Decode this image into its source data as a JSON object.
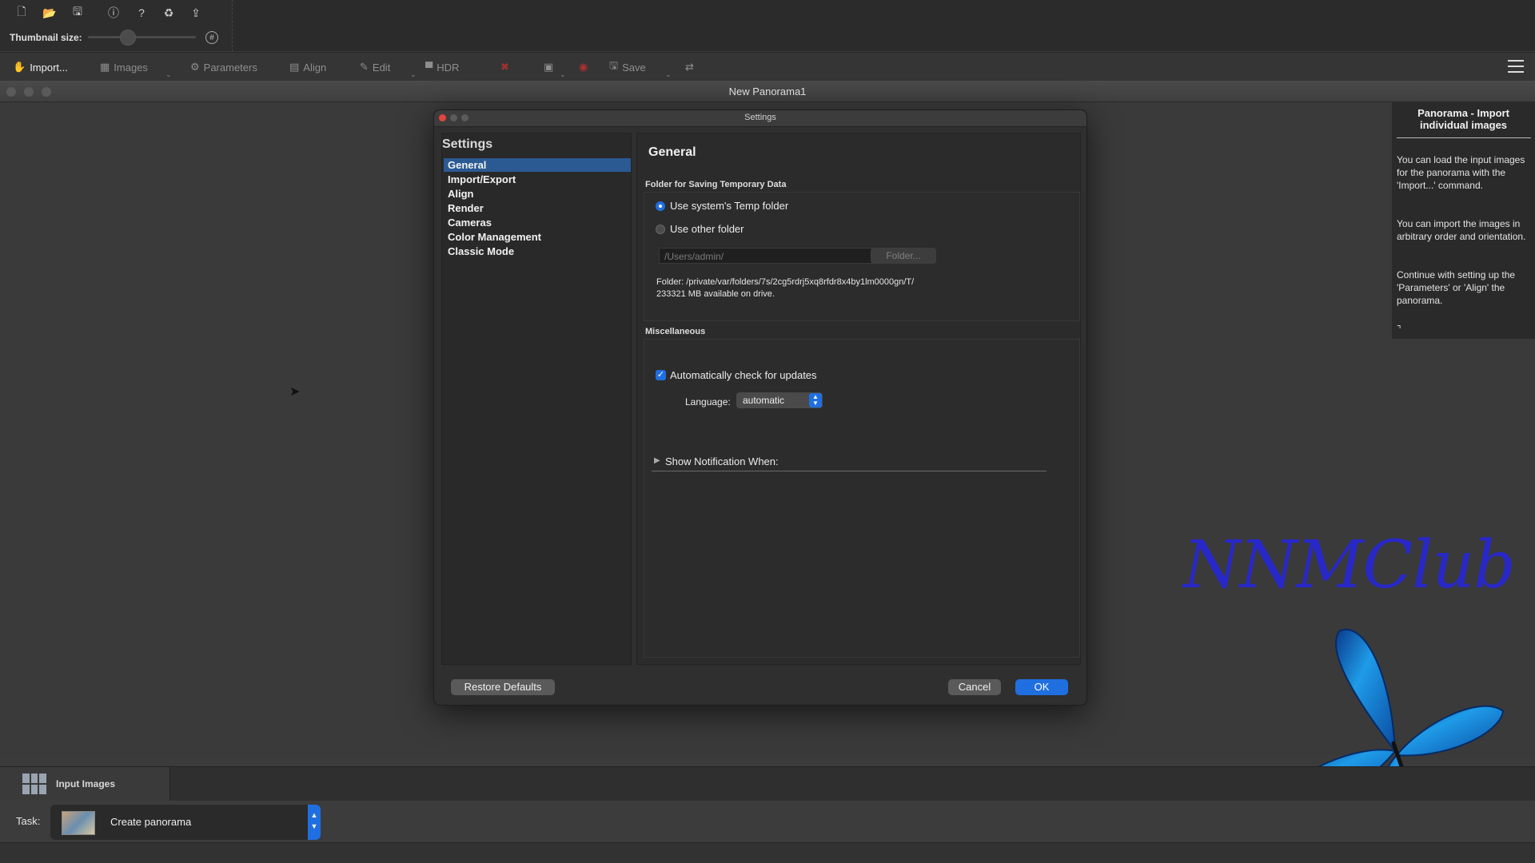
{
  "toolbar": {
    "thumbnail_label": "Thumbnail size:",
    "icons": [
      "new-file-icon",
      "open-folder-icon",
      "save-disk-icon",
      "info-icon",
      "help-icon",
      "recycle-icon",
      "export-icon"
    ]
  },
  "workflow": {
    "import": "Import...",
    "images": "Images",
    "parameters": "Parameters",
    "align": "Align",
    "edit": "Edit",
    "hdr": "HDR",
    "save": "Save"
  },
  "window": {
    "title": "New Panorama1"
  },
  "dialog": {
    "title": "Settings",
    "sidebar_heading": "Settings",
    "sidebar_items": [
      "General",
      "Import/Export",
      "Align",
      "Render",
      "Cameras",
      "Color Management",
      "Classic Mode"
    ],
    "selected_item": "General",
    "panel_title": "General",
    "temp_group_label": "Folder for Saving Temporary Data",
    "radio_system": "Use system's Temp folder",
    "radio_other": "Use other folder",
    "path_value": "/Users/admin/",
    "folder_button": "Folder...",
    "folder_info": "Folder: /private/var/folders/7s/2cg5rdrj5xq8rfdr8x4by1lm0000gn/T/",
    "space_info": "233321 MB available on drive.",
    "misc_group_label": "Miscellaneous",
    "auto_update_label": "Automatically check for updates",
    "auto_update_checked": true,
    "language_label": "Language:",
    "language_value": "automatic",
    "notification_label": "Show Notification When:",
    "restore_button": "Restore Defaults",
    "cancel_button": "Cancel",
    "ok_button": "OK"
  },
  "help": {
    "title": "Panorama - Import individual images",
    "p1": "You can load the input images for the panorama with the 'Import...' command.",
    "p2": "You can import the images in arbitrary order and orientation.",
    "p3": "Continue with setting up the 'Parameters' or 'Align' the panorama."
  },
  "watermark": "NNMClub",
  "bottom": {
    "input_tab": "Input Images",
    "task_label": "Task:",
    "task_value": "Create panorama"
  },
  "colors": {
    "accent": "#1f6fe0",
    "selection": "#2b5a93",
    "watermark": "#2828c8"
  }
}
